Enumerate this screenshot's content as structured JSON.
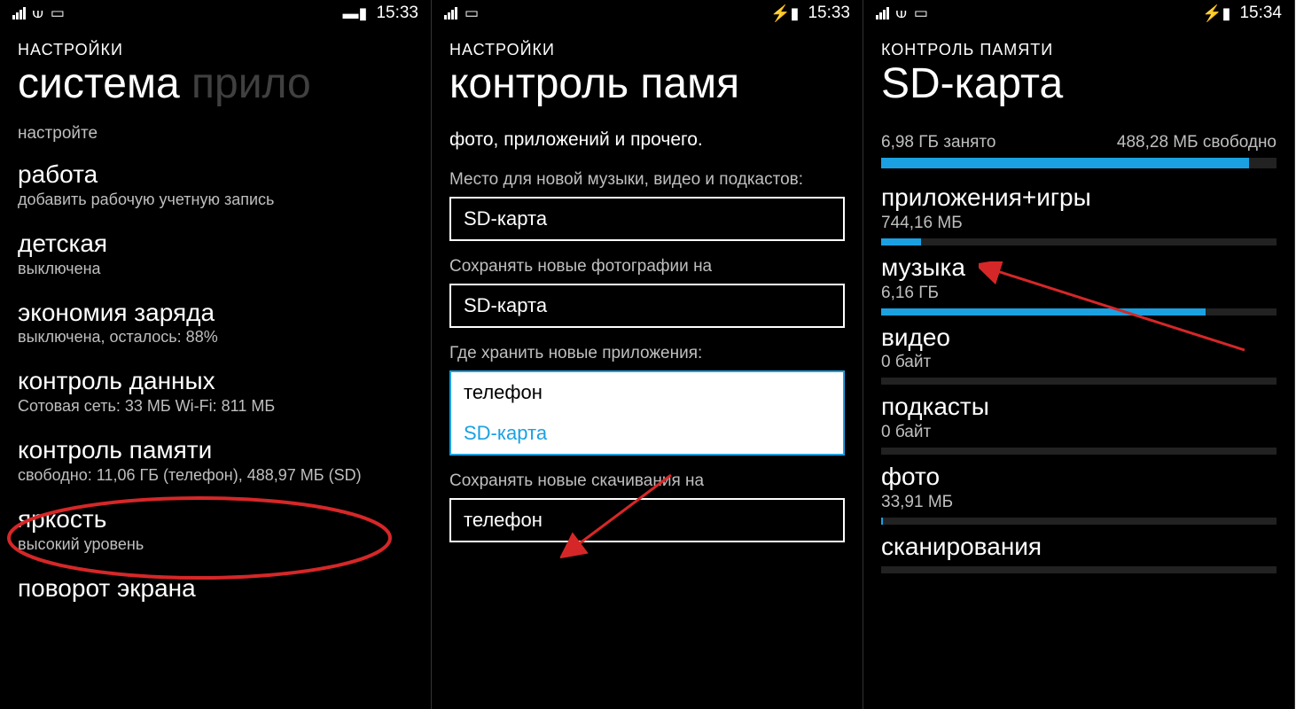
{
  "screen1": {
    "statusbar": {
      "time": "15:33"
    },
    "breadcrumb": "НАСТРОЙКИ",
    "title_active": "система",
    "title_faded": "прило",
    "subheading": "настройте",
    "items": [
      {
        "label": "работа",
        "sub": "добавить рабочую учетную запись"
      },
      {
        "label": "детская",
        "sub": "выключена"
      },
      {
        "label": "экономия заряда",
        "sub": "выключена, осталось: 88%"
      },
      {
        "label": "контроль данных",
        "sub": "Сотовая сеть: 33 МБ Wi-Fi: 811 МБ"
      },
      {
        "label": "контроль памяти",
        "sub": "свободно: 11,06 ГБ (телефон), 488,97 МБ (SD)"
      },
      {
        "label": "яркость",
        "sub": "высокий уровень"
      },
      {
        "label": "поворот экрана",
        "sub": ""
      }
    ]
  },
  "screen2": {
    "statusbar": {
      "time": "15:33"
    },
    "breadcrumb": "НАСТРОЙКИ",
    "title": "контроль памя",
    "desc_partial": "фото, приложений и прочего.",
    "fields": [
      {
        "label": "Место для новой музыки, видео и подкастов:",
        "value": "SD-карта"
      },
      {
        "label": "Сохранять новые фотографии на",
        "value": "SD-карта"
      }
    ],
    "dropdown": {
      "label": "Где хранить новые приложения:",
      "options": [
        "телефон",
        "SD-карта"
      ],
      "selected": "SD-карта"
    },
    "field_last": {
      "label": "Сохранять новые скачивания на",
      "value": "телефон"
    }
  },
  "screen3": {
    "statusbar": {
      "time": "15:34"
    },
    "breadcrumb": "КОНТРОЛЬ ПАМЯТИ",
    "title": "SD-карта",
    "used": "6,98 ГБ занято",
    "free": "488,28 МБ свободно",
    "used_percent": 93,
    "categories": [
      {
        "label": "приложения+игры",
        "size": "744,16 МБ",
        "percent": 10
      },
      {
        "label": "музыка",
        "size": "6,16 ГБ",
        "percent": 82
      },
      {
        "label": "видео",
        "size": "0 байт",
        "percent": 0
      },
      {
        "label": "подкасты",
        "size": "0 байт",
        "percent": 0
      },
      {
        "label": "фото",
        "size": "33,91 МБ",
        "percent": 0.5
      },
      {
        "label": "сканирования",
        "size": "",
        "percent": 0
      }
    ]
  }
}
